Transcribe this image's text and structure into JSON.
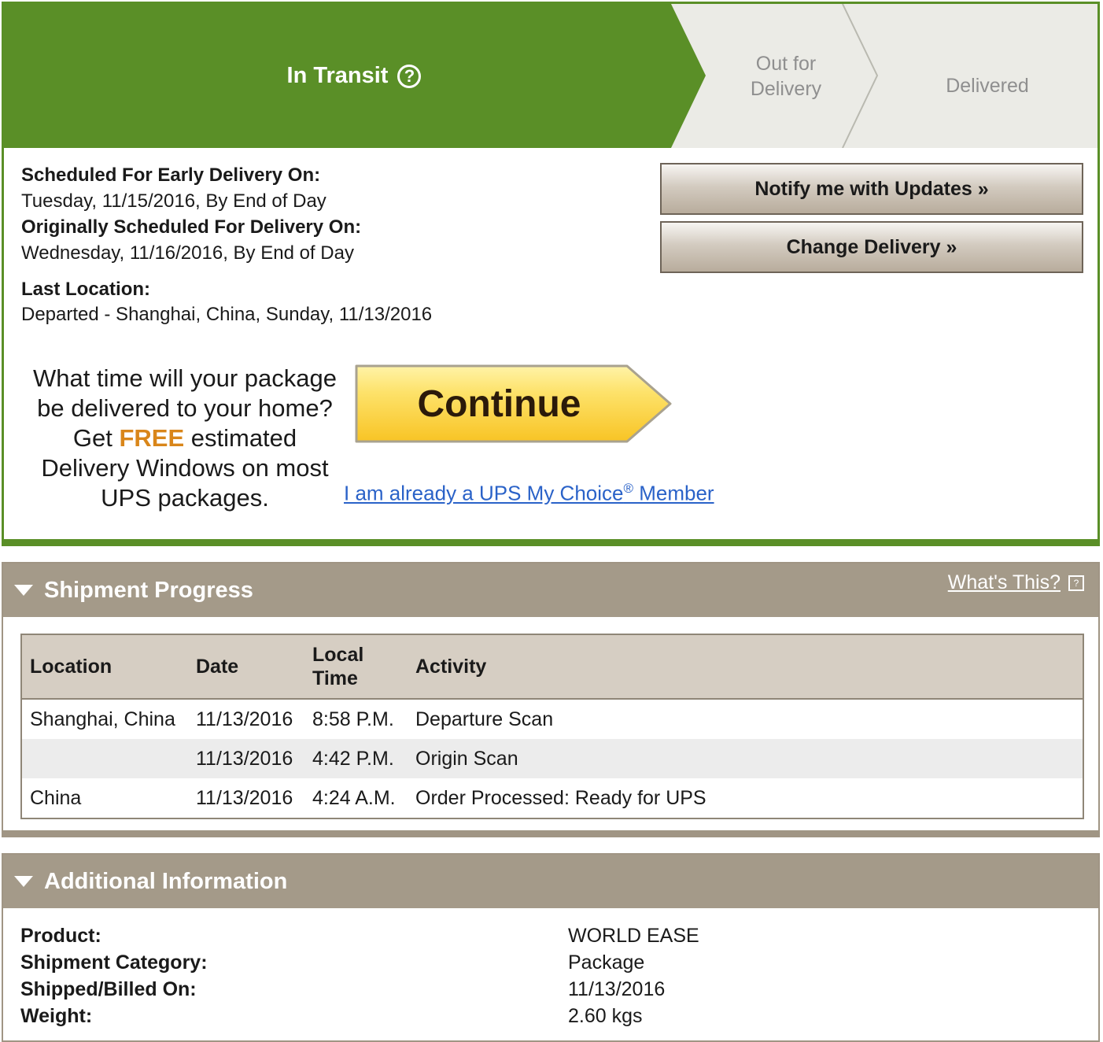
{
  "progress": {
    "current_step": "In Transit",
    "out_for_line1": "Out for",
    "out_for_line2": "Delivery",
    "delivered": "Delivered",
    "help_glyph": "?",
    "colors": {
      "active": "#5a8f27",
      "inactive": "#ebebe6",
      "chevron_line": "#b9b9b0"
    }
  },
  "schedule": {
    "early_label": "Scheduled For Early Delivery On:",
    "early_value": "Tuesday, 11/15/2016, By End of Day",
    "original_label": "Originally Scheduled For Delivery On:",
    "original_value": "Wednesday, 11/16/2016, By End of Day",
    "last_location_label": "Last Location:",
    "last_location_value": "Departed - Shanghai, China, Sunday, 11/13/2016"
  },
  "actions": {
    "notify": "Notify me with Updates »",
    "change": "Change Delivery »"
  },
  "promo": {
    "line1": "What time will your package",
    "line2": "be delivered to your home?",
    "get": "Get",
    "free": "FREE",
    "estimated": "estimated",
    "line4": "Delivery Windows on most",
    "line5": "UPS packages.",
    "continue_label": "Continue",
    "member_link_pre": "I am already a UPS My Choice",
    "member_link_reg": "®",
    "member_link_post": " Member"
  },
  "shipment_progress": {
    "title": "Shipment Progress",
    "whats_this": "What's This?",
    "columns": [
      "Location",
      "Date",
      "Local Time",
      "Activity"
    ],
    "local_time_line1": "Local",
    "local_time_line2": "Time",
    "rows": [
      {
        "location": "Shanghai, China",
        "date": "11/13/2016",
        "time": "8:58 P.M.",
        "activity": "Departure Scan"
      },
      {
        "location": "",
        "date": "11/13/2016",
        "time": "4:42 P.M.",
        "activity": "Origin Scan"
      },
      {
        "location": "China",
        "date": "11/13/2016",
        "time": "4:24 A.M.",
        "activity": "Order Processed: Ready for UPS"
      }
    ]
  },
  "additional_info": {
    "title": "Additional Information",
    "items": [
      {
        "label": "Product:",
        "value": "WORLD EASE"
      },
      {
        "label": "Shipment Category:",
        "value": "Package"
      },
      {
        "label": "Shipped/Billed On:",
        "value": "11/13/2016"
      },
      {
        "label": "Weight:",
        "value": "2.60 kgs"
      }
    ]
  }
}
